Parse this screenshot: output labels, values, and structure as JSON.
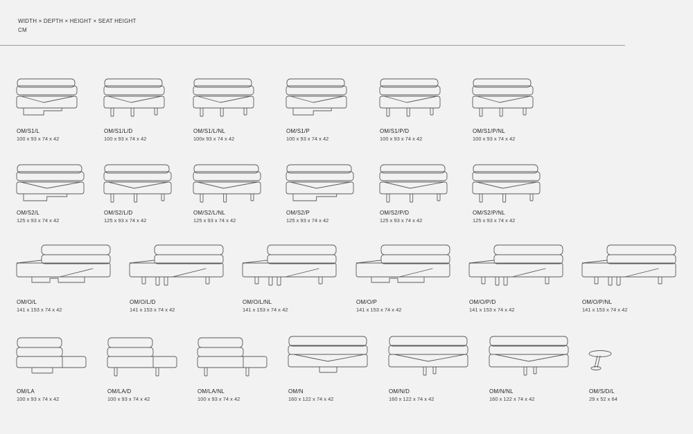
{
  "header": {
    "dimension_legend": "WIDTH × DEPTH × HEIGHT × SEAT HEIGHT",
    "unit": "CM"
  },
  "products": [
    {
      "code": "OM/S1/L",
      "dims": "100 x 93 x 74 x 42",
      "shape": "s1",
      "base": "block"
    },
    {
      "code": "OM/S1/L/D",
      "dims": "100 x 93 x 74 x 42",
      "shape": "s1",
      "base": "legs"
    },
    {
      "code": "OM/S1/L/NL",
      "dims": "100x 93 x 74 x 42",
      "shape": "s1",
      "base": "legs"
    },
    {
      "code": "OM/S1/P",
      "dims": "100 x 93 x 74 x 42",
      "shape": "s1",
      "base": "block"
    },
    {
      "code": "OM/S1/P/D",
      "dims": "100 x 93 x 74 x 42",
      "shape": "s1",
      "base": "legs"
    },
    {
      "code": "OM/S1/P/NL",
      "dims": "100 x 93 x 74 x 42",
      "shape": "s1",
      "base": "legs"
    },
    {
      "code": "OM/S2/L",
      "dims": "125 x 93 x 74 x 42",
      "shape": "s2",
      "base": "block"
    },
    {
      "code": "OM/S2/L/D",
      "dims": "125 x 93 x 74 x 42",
      "shape": "s2",
      "base": "legs"
    },
    {
      "code": "OM/S2/L/NL",
      "dims": "125 x 93 x 74 x 42",
      "shape": "s2",
      "base": "legs"
    },
    {
      "code": "OM/S2/P",
      "dims": "125 x 93 x 74 x 42",
      "shape": "s2",
      "base": "block"
    },
    {
      "code": "OM/S2/P/D",
      "dims": "125 x 93 x 74 x 42",
      "shape": "s2",
      "base": "legs"
    },
    {
      "code": "OM/S2/P/NL",
      "dims": "125 x 93 x 74 x 42",
      "shape": "s2",
      "base": "legs"
    },
    {
      "code": "OM/O/L",
      "dims": "141 x 153 x 74 x 42",
      "shape": "o",
      "base": "block"
    },
    {
      "code": "OM/O/L/D",
      "dims": "141 x 153 x 74 x 42",
      "shape": "o",
      "base": "legs"
    },
    {
      "code": "OM/O/L/NL",
      "dims": "141 x 153 x 74 x 42",
      "shape": "o",
      "base": "legs"
    },
    {
      "code": "OM/O/P",
      "dims": "141 x 153 x 74 x 42",
      "shape": "o",
      "base": "block"
    },
    {
      "code": "OM/O/P/D",
      "dims": "141 x 153 x 74 x 42",
      "shape": "o",
      "base": "legs"
    },
    {
      "code": "OM/O/P/NL",
      "dims": "141 x 153 x 74 x 42",
      "shape": "o",
      "base": "legs"
    },
    {
      "code": "OM/LA",
      "dims": "100 x 93 x 74 x 42",
      "shape": "la",
      "base": "block"
    },
    {
      "code": "OM/LA/D",
      "dims": "100 x 93 x 74 x 42",
      "shape": "la",
      "base": "legs"
    },
    {
      "code": "OM/LA/NL",
      "dims": "100 x 93 x 74 x 42",
      "shape": "la",
      "base": "legs"
    },
    {
      "code": "OM/N",
      "dims": "160 x 122 x 74 x 42",
      "shape": "n",
      "base": "block"
    },
    {
      "code": "OM/N/D",
      "dims": "160 x 122 x 74 x 42",
      "shape": "n",
      "base": "legs"
    },
    {
      "code": "OM/N/NL",
      "dims": "160 x 122 x 74 x 42",
      "shape": "n",
      "base": "legs"
    },
    {
      "code": "OM/S/D/L",
      "dims": "29 x 52 x 64",
      "shape": "table",
      "base": "none"
    }
  ]
}
